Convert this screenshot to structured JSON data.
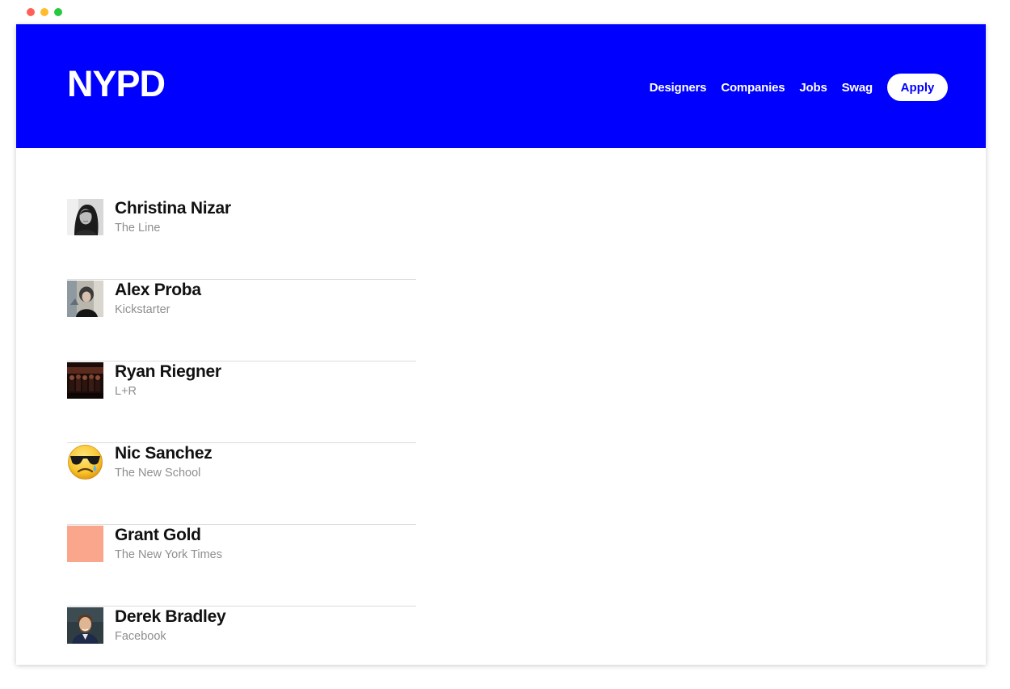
{
  "window_controls": {
    "colors": [
      "#ff5f57",
      "#febc2e",
      "#28c840"
    ]
  },
  "header": {
    "background": "#0000ff",
    "logo": "NYPD",
    "nav": [
      "Designers",
      "Companies",
      "Jobs",
      "Swag"
    ],
    "apply_label": "Apply"
  },
  "designers": [
    {
      "name": "Christina Nizar",
      "company": "The Line",
      "avatar": "portrait-photo-bw"
    },
    {
      "name": "Alex Proba",
      "company": "Kickstarter",
      "avatar": "portrait-photo"
    },
    {
      "name": "Ryan Riegner",
      "company": "L+R",
      "avatar": "group-photo-dark"
    },
    {
      "name": "Nic Sanchez",
      "company": "The New School",
      "avatar": "sunglasses-tear-emoji"
    },
    {
      "name": "Grant Gold",
      "company": "The New York Times",
      "avatar": "salmon-square",
      "avatar_color": "#f9a68c"
    },
    {
      "name": "Derek Bradley",
      "company": "Facebook",
      "avatar": "portrait-photo"
    }
  ]
}
